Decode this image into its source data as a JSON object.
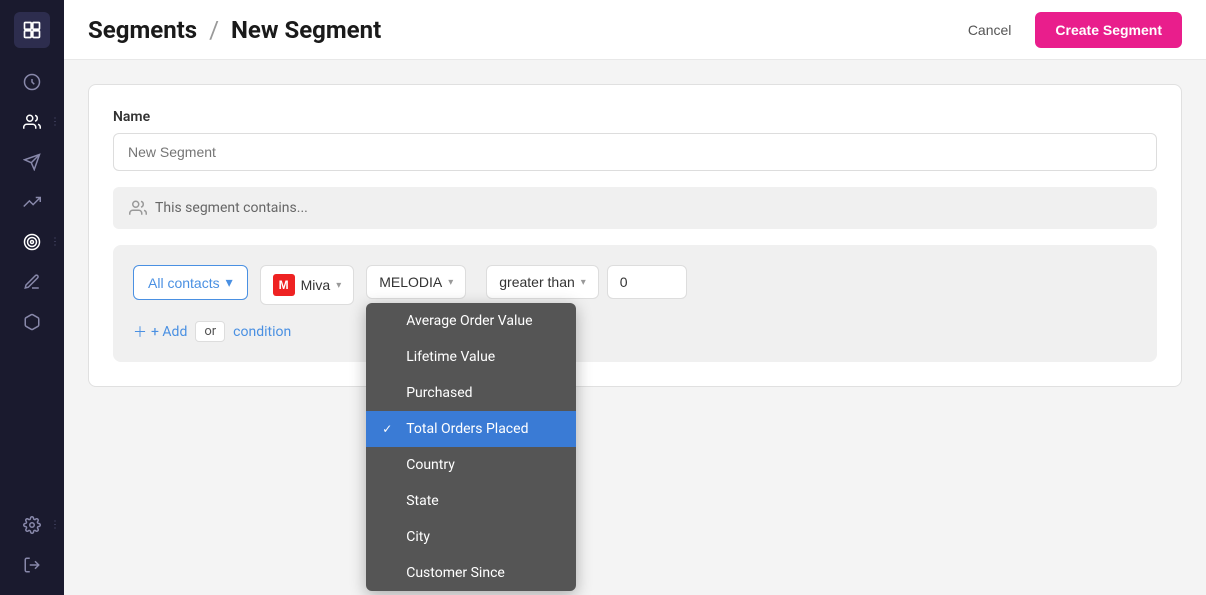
{
  "sidebar": {
    "items": [
      {
        "name": "dashboard",
        "icon": "speedometer"
      },
      {
        "name": "contacts",
        "icon": "people"
      },
      {
        "name": "campaigns",
        "icon": "paper-plane"
      },
      {
        "name": "automations",
        "icon": "cloud"
      },
      {
        "name": "segments",
        "icon": "target"
      },
      {
        "name": "editor",
        "icon": "pencil"
      },
      {
        "name": "products",
        "icon": "box"
      },
      {
        "name": "settings",
        "icon": "gear"
      },
      {
        "name": "logout",
        "icon": "exit"
      }
    ]
  },
  "header": {
    "breadcrumb_root": "Segments",
    "separator": "/",
    "page_title": "New Segment",
    "cancel_label": "Cancel",
    "create_label": "Create Segment"
  },
  "form": {
    "name_label": "Name",
    "name_placeholder": "New Segment",
    "segment_contains_text": "This segment contains..."
  },
  "filter": {
    "all_contacts_label": "All contacts",
    "integration_label": "Miva",
    "integration_dropdown_label": "MELODIA",
    "dropdown_items": [
      {
        "id": "avg_order_value",
        "label": "Average Order Value",
        "selected": false
      },
      {
        "id": "lifetime_value",
        "label": "Lifetime Value",
        "selected": false
      },
      {
        "id": "purchased",
        "label": "Purchased",
        "selected": false
      },
      {
        "id": "total_orders_placed",
        "label": "Total Orders Placed",
        "selected": true
      },
      {
        "id": "country",
        "label": "Country",
        "selected": false
      },
      {
        "id": "state",
        "label": "State",
        "selected": false
      },
      {
        "id": "city",
        "label": "City",
        "selected": false
      },
      {
        "id": "customer_since",
        "label": "Customer Since",
        "selected": false
      }
    ],
    "add_label": "+ Add",
    "or_label": "or",
    "condition_label": "condition"
  }
}
